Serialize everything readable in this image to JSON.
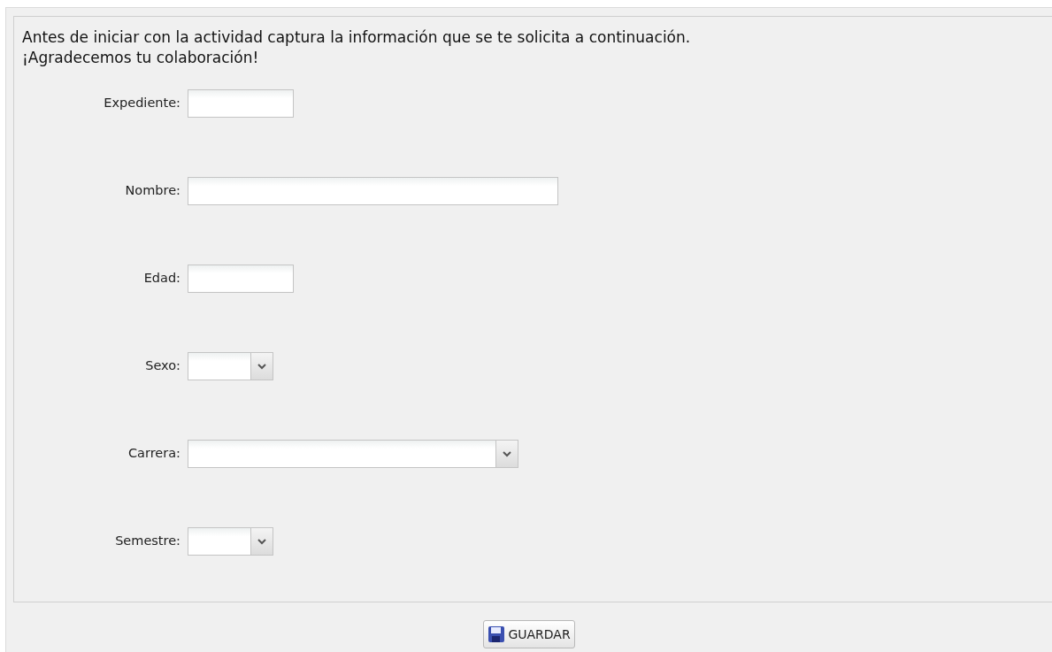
{
  "intro": [
    "Antes de iniciar con la actividad captura la información que se te solicita a continuación.",
    "¡Agradecemos tu colaboración!"
  ],
  "fields": [
    {
      "label": "Expediente:",
      "kind": "text"
    },
    {
      "label": "Nombre:",
      "kind": "text"
    },
    {
      "label": "Edad:",
      "kind": "text"
    },
    {
      "label": "Sexo:",
      "kind": "select"
    },
    {
      "label": "Carrera:",
      "kind": "select"
    },
    {
      "label": "Semestre:",
      "kind": "select"
    }
  ],
  "save_button": {
    "label": "GUARDAR"
  }
}
